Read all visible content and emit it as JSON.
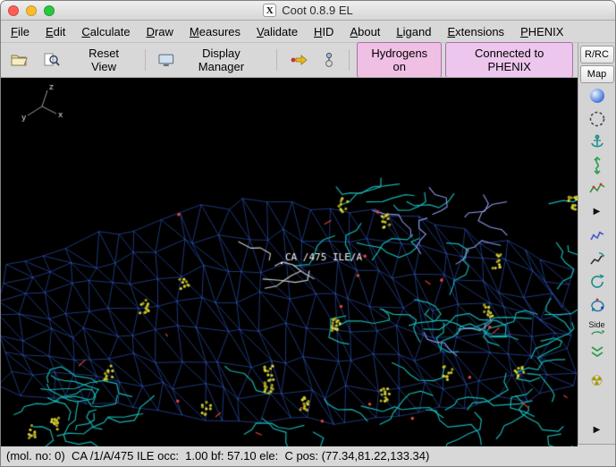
{
  "window": {
    "title": "Coot 0.8.9 EL"
  },
  "icons": {
    "x11_logo": "X",
    "play_arrow": "▶",
    "radiation": "☢"
  },
  "menubar": {
    "items": [
      {
        "label": "File"
      },
      {
        "label": "Edit"
      },
      {
        "label": "Calculate"
      },
      {
        "label": "Draw"
      },
      {
        "label": "Measures"
      },
      {
        "label": "Validate"
      },
      {
        "label": "HID"
      },
      {
        "label": "About"
      },
      {
        "label": "Ligand"
      },
      {
        "label": "Extensions"
      },
      {
        "label": "PHENIX"
      }
    ]
  },
  "toolbar": {
    "reset_view_label": "Reset View",
    "display_manager_label": "Display Manager",
    "hydrogens_label": "Hydrogens on",
    "phenix_label": "Connected to PHENIX"
  },
  "sidebar": {
    "rrc_label": "R/RC",
    "map_label": "Map",
    "side_label": "Side"
  },
  "viewport": {
    "atom_label": "CA /475 ILE/A",
    "axis_labels": [
      "x",
      "y",
      "z"
    ]
  },
  "statusbar": {
    "text": "(mol. no: 0)  CA /1/A/475 ILE occ:  1.00 bf: 57.10 ele:  C pos: (77.34,81.22,133.34)"
  },
  "colors": {
    "mesh_blue": "#4074ff",
    "stick_teal": "#18b2b2",
    "stick_violet": "#8f9bea",
    "stick_gray": "#cfcfcf",
    "dots_yellow": "#c9c42f",
    "dots_red": "#e04545",
    "label_white": "#f0f0f0",
    "hydrogens_bg": "#f0bfe4",
    "phenix_bg": "#ecc6ec",
    "traffic_close": "#ff5f57",
    "traffic_min": "#febc2e",
    "traffic_zoom": "#28c840"
  }
}
